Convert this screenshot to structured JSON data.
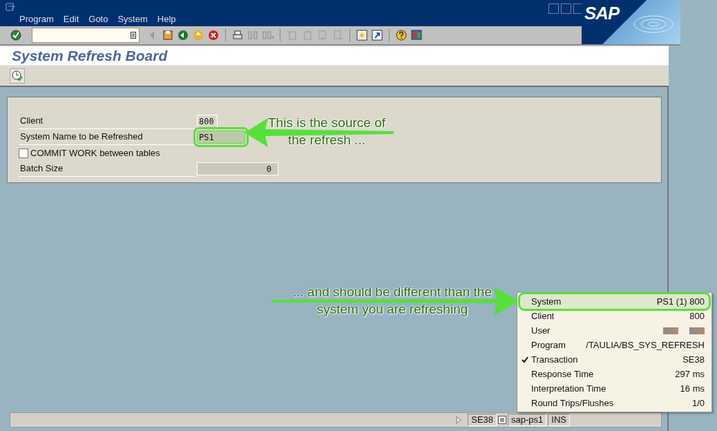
{
  "window": {
    "menu": [
      "Program",
      "Edit",
      "Goto",
      "System",
      "Help"
    ],
    "logo": "SAP"
  },
  "title": "System Refresh Board",
  "form": {
    "rows": [
      {
        "kind": "field",
        "label": "Client",
        "value": "800",
        "highlighted": false,
        "disabled": false
      },
      {
        "kind": "field",
        "label": "System Name to be Refreshed",
        "value": "PS1",
        "highlighted": true,
        "disabled": false
      },
      {
        "kind": "checkbox",
        "label": "COMMIT WORK between tables",
        "checked": false
      },
      {
        "kind": "field",
        "label": "Batch Size",
        "value": "0",
        "highlighted": false,
        "disabled": true
      }
    ]
  },
  "status_bar": {
    "items": [
      "SE38",
      "sap-ps1",
      "INS"
    ]
  },
  "system_menu": {
    "items": [
      {
        "kind": "text",
        "label": "System",
        "value": "PS1 (1) 800",
        "selected": true,
        "checked": false
      },
      {
        "kind": "text",
        "label": "Client",
        "value": "800",
        "selected": false,
        "checked": false
      },
      {
        "kind": "redacted",
        "label": "User",
        "selected": false,
        "checked": false
      },
      {
        "kind": "text",
        "label": "Program",
        "value": "/TAULIA/BS_SYS_REFRESH",
        "selected": false,
        "checked": false
      },
      {
        "kind": "text",
        "label": "Transaction",
        "value": "SE38",
        "selected": false,
        "checked": true
      },
      {
        "kind": "text",
        "label": "Response Time",
        "value": "297 ms",
        "selected": false,
        "checked": false
      },
      {
        "kind": "text",
        "label": "Interpretation Time",
        "value": "16 ms",
        "selected": false,
        "checked": false
      },
      {
        "kind": "text",
        "label": "Round Trips/Flushes",
        "value": "1/0",
        "selected": false,
        "checked": false
      }
    ]
  },
  "annotations": [
    {
      "kind": "arrow-left",
      "text": "This is the source of the refresh ..."
    },
    {
      "kind": "arrow-right",
      "text": "... and should be different than the system you are refreshing"
    }
  ]
}
